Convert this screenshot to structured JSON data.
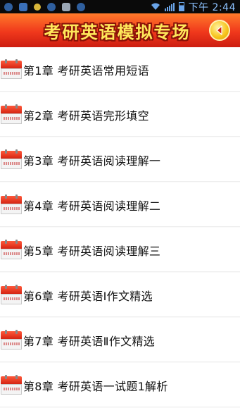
{
  "status_bar": {
    "time": "下午 2:44"
  },
  "header": {
    "title": "考研英语模拟专场",
    "back_icon": "back-arrow-icon"
  },
  "colors": {
    "header_top": "#ff7a2a",
    "header_bottom": "#cc1d10",
    "title_text": "#ffe85a",
    "back_button": "#f6c21a"
  },
  "chapters": [
    {
      "label": "第1章  考研英语常用短语",
      "icon": "calendar-icon"
    },
    {
      "label": "第2章  考研英语完形填空",
      "icon": "calendar-icon"
    },
    {
      "label": "第3章  考研英语阅读理解一",
      "icon": "calendar-icon"
    },
    {
      "label": "第4章  考研英语阅读理解二",
      "icon": "calendar-icon"
    },
    {
      "label": "第5章  考研英语阅读理解三",
      "icon": "calendar-icon"
    },
    {
      "label": "第6章  考研英语Ⅰ作文精选",
      "icon": "calendar-icon"
    },
    {
      "label": "第7章  考研英语Ⅱ作文精选",
      "icon": "calendar-icon"
    },
    {
      "label": "第8章  考研英语一试题1解析",
      "icon": "calendar-icon"
    }
  ]
}
